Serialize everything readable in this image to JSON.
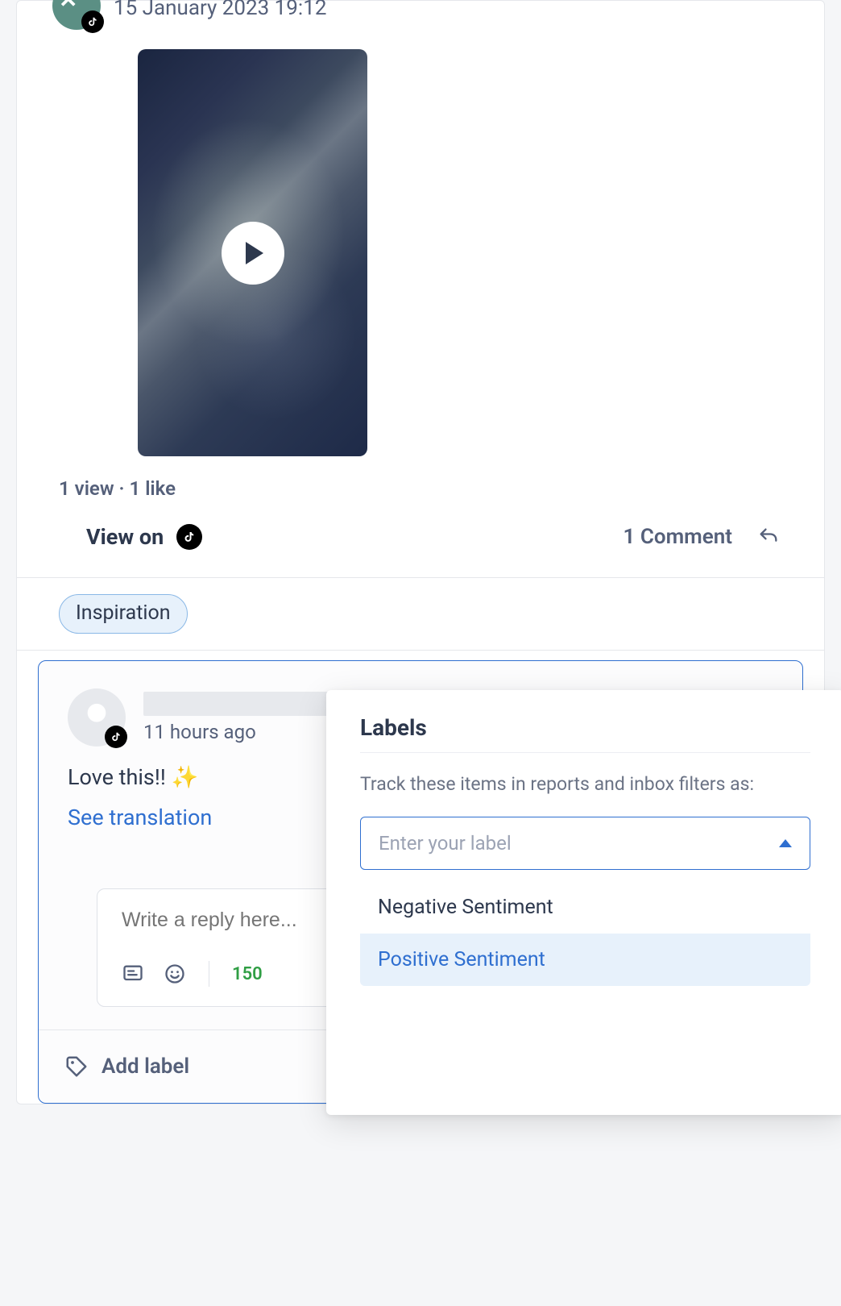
{
  "post": {
    "timestamp": "15 January 2023 19:12",
    "stats": "1 view · 1 like",
    "view_on_label": "View on",
    "comment_count_label": "1 Comment"
  },
  "labels_bar": {
    "chip": "Inspiration"
  },
  "comment": {
    "time": "11 hours ago",
    "text": "Love this!! ",
    "emoji": "✨",
    "see_translation": "See translation"
  },
  "reply": {
    "placeholder": "Write a reply here...",
    "char_count": "150"
  },
  "add_label": {
    "label": "Add label"
  },
  "popover": {
    "title": "Labels",
    "description": "Track these items in reports and inbox filters as:",
    "input_placeholder": "Enter your label",
    "options": [
      "Negative Sentiment",
      "Positive Sentiment"
    ],
    "selected_index": 1
  }
}
